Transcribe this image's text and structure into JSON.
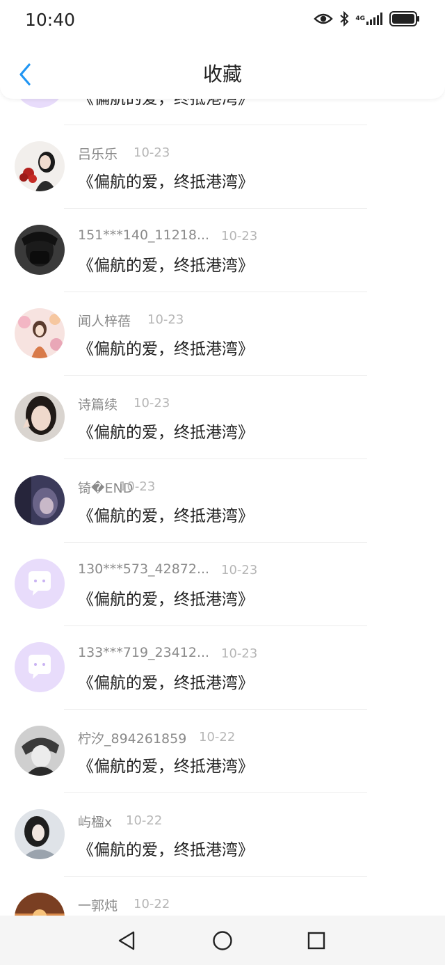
{
  "status_bar": {
    "time": "10:40",
    "network": "4G",
    "icons": [
      "eye-icon",
      "bluetooth-icon",
      "signal-icon",
      "battery-icon"
    ]
  },
  "header": {
    "title": "收藏",
    "back_icon": "chevron-left-icon"
  },
  "accent_color": "#2196f3",
  "list": {
    "items": [
      {
        "name": "",
        "date": "",
        "text": "《偏航的爱，终抵港湾》",
        "avatar": "default-purple"
      },
      {
        "name": "吕乐乐",
        "date": "10-23",
        "text": "《偏航的爱，终抵港湾》",
        "avatar": "photo"
      },
      {
        "name": "151***140_11218...",
        "date": "10-23",
        "text": "《偏航的爱，终抵港湾》",
        "avatar": "photo"
      },
      {
        "name": "闻人梓蓓",
        "date": "10-23",
        "text": "《偏航的爱，终抵港湾》",
        "avatar": "photo"
      },
      {
        "name": "诗篇续",
        "date": "10-23",
        "text": "《偏航的爱，终抵港湾》",
        "avatar": "photo"
      },
      {
        "name": "锜�END",
        "date": "10-23",
        "text": "《偏航的爱，终抵港湾》",
        "avatar": "photo"
      },
      {
        "name": "130***573_42872...",
        "date": "10-23",
        "text": "《偏航的爱，终抵港湾》",
        "avatar": "default-purple"
      },
      {
        "name": "133***719_23412...",
        "date": "10-23",
        "text": "《偏航的爱，终抵港湾》",
        "avatar": "default-purple"
      },
      {
        "name": "柠汐_894261859",
        "date": "10-22",
        "text": "《偏航的爱，终抵港湾》",
        "avatar": "photo"
      },
      {
        "name": "屿楹x",
        "date": "10-22",
        "text": "《偏航的爱，终抵港湾》",
        "avatar": "photo"
      },
      {
        "name": "一郭炖",
        "date": "10-22",
        "text": "",
        "avatar": "photo"
      }
    ]
  },
  "nav_bar": {
    "icons": [
      "back-triangle-icon",
      "home-circle-icon",
      "recents-square-icon"
    ]
  }
}
